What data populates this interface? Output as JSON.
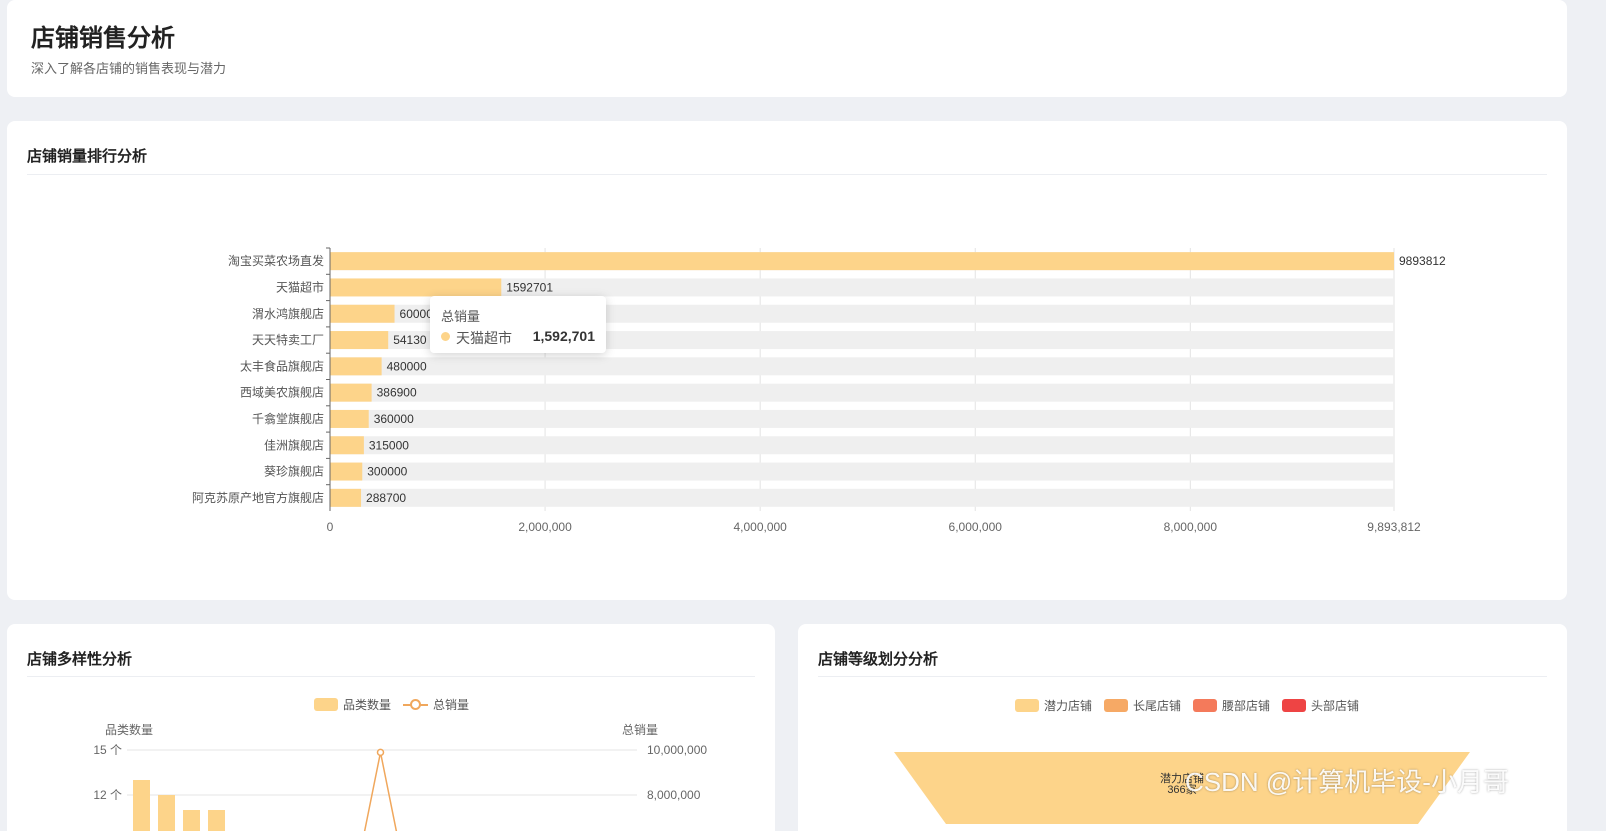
{
  "header": {
    "title": "店铺销售分析",
    "subtitle": "深入了解各店铺的销售表现与潜力"
  },
  "ranking": {
    "title": "店铺销量排行分析",
    "chart_data": {
      "type": "bar",
      "orientation": "horizontal",
      "categories": [
        "淘宝买菜农场直发",
        "天猫超市",
        "渭水鸿旗舰店",
        "天天特卖工厂",
        "太丰食品旗舰店",
        "西域美农旗舰店",
        "千翕堂旗舰店",
        "佳洲旗舰店",
        "葵珍旗舰店",
        "阿克苏原产地官方旗舰店"
      ],
      "values": [
        9893812,
        1592701,
        600000,
        541303,
        480000,
        386900,
        360000,
        315000,
        300000,
        288700
      ],
      "value_labels": [
        "9893812",
        "1592701",
        "60000",
        "54130",
        "480000",
        "386900",
        "360000",
        "315000",
        "300000",
        "288700"
      ],
      "xlim": [
        0,
        9893812
      ],
      "x_tick_labels": [
        "0",
        "2,000,000",
        "4,000,000",
        "6,000,000",
        "8,000,000",
        "9,893,812"
      ],
      "grid": true,
      "color": "#fdd48a",
      "background_bar_color": "#efefef"
    },
    "tooltip": {
      "title": "总销量",
      "name": "天猫超市",
      "value": "1,592,701"
    }
  },
  "diversity": {
    "title": "店铺多样性分析",
    "legend": [
      {
        "label": "品类数量",
        "color": "#fdd48a",
        "kind": "bar"
      },
      {
        "label": "总销量",
        "color": "#f0a75c",
        "kind": "line"
      }
    ],
    "left_axis_name": "品类数量",
    "right_axis_name": "总销量",
    "left_ticks": [
      "15 个",
      "12 个"
    ],
    "right_ticks": [
      "10,000,000",
      "8,000,000"
    ],
    "chart_data": {
      "type": "bar",
      "series": [
        {
          "name": "品类数量",
          "values": [
            13,
            12,
            11,
            11
          ]
        },
        {
          "name": "总销量",
          "values": [
            0,
            0,
            0,
            0,
            0,
            0,
            0,
            0,
            0,
            0,
            0,
            9893812,
            0
          ]
        }
      ],
      "ylim_left": [
        0,
        15
      ],
      "ylim_right": [
        0,
        10000000
      ]
    }
  },
  "level": {
    "title": "店铺等级划分分析",
    "legend": [
      {
        "label": "潜力店铺",
        "color": "#fdd48a"
      },
      {
        "label": "长尾店铺",
        "color": "#f6a965"
      },
      {
        "label": "腰部店铺",
        "color": "#f47a5b"
      },
      {
        "label": "头部店铺",
        "color": "#ee4444"
      }
    ],
    "funnel_label": "潜力店铺",
    "funnel_value": "366家"
  },
  "watermark": "CSDN @计算机毕设-小月哥"
}
